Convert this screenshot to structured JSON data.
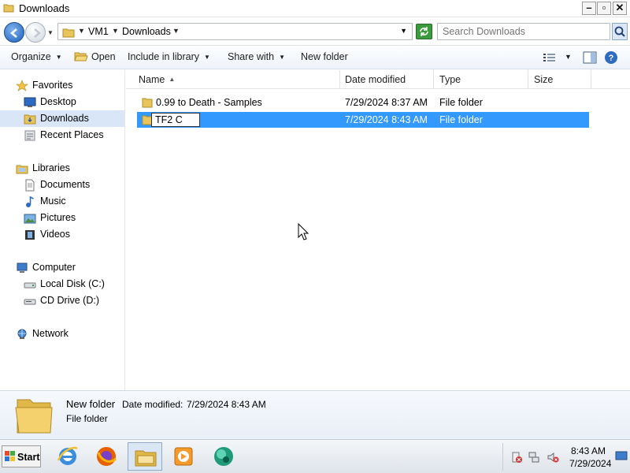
{
  "window": {
    "title": "Downloads"
  },
  "address": {
    "segments": [
      "VM1",
      "Downloads"
    ],
    "search_placeholder": "Search Downloads"
  },
  "toolbar": {
    "organize": "Organize",
    "open": "Open",
    "include_in_library": "Include in library",
    "share_with": "Share with",
    "new_folder": "New folder"
  },
  "nav": {
    "favorites": "Favorites",
    "desktop": "Desktop",
    "downloads": "Downloads",
    "recent_places": "Recent Places",
    "libraries": "Libraries",
    "documents": "Documents",
    "music": "Music",
    "pictures": "Pictures",
    "videos": "Videos",
    "computer": "Computer",
    "local_disk": "Local Disk (C:)",
    "cd_drive": "CD Drive (D:)",
    "network": "Network"
  },
  "columns": {
    "name": "Name",
    "date_modified": "Date modified",
    "type": "Type",
    "size": "Size"
  },
  "files": [
    {
      "name": "0.99 to Death - Samples",
      "date": "7/29/2024 8:37 AM",
      "type": "File folder"
    },
    {
      "name": "TF2 C",
      "date": "7/29/2024 8:43 AM",
      "type": "File folder"
    }
  ],
  "details": {
    "name": "New folder",
    "modified_label": "Date modified:",
    "modified_value": "7/29/2024 8:43 AM",
    "type": "File folder"
  },
  "taskbar": {
    "start": "Start",
    "time": "8:43 AM",
    "date": "7/29/2024"
  },
  "colors": {
    "selection": "#3399ff",
    "nav_selected": "#d9e6f7"
  }
}
